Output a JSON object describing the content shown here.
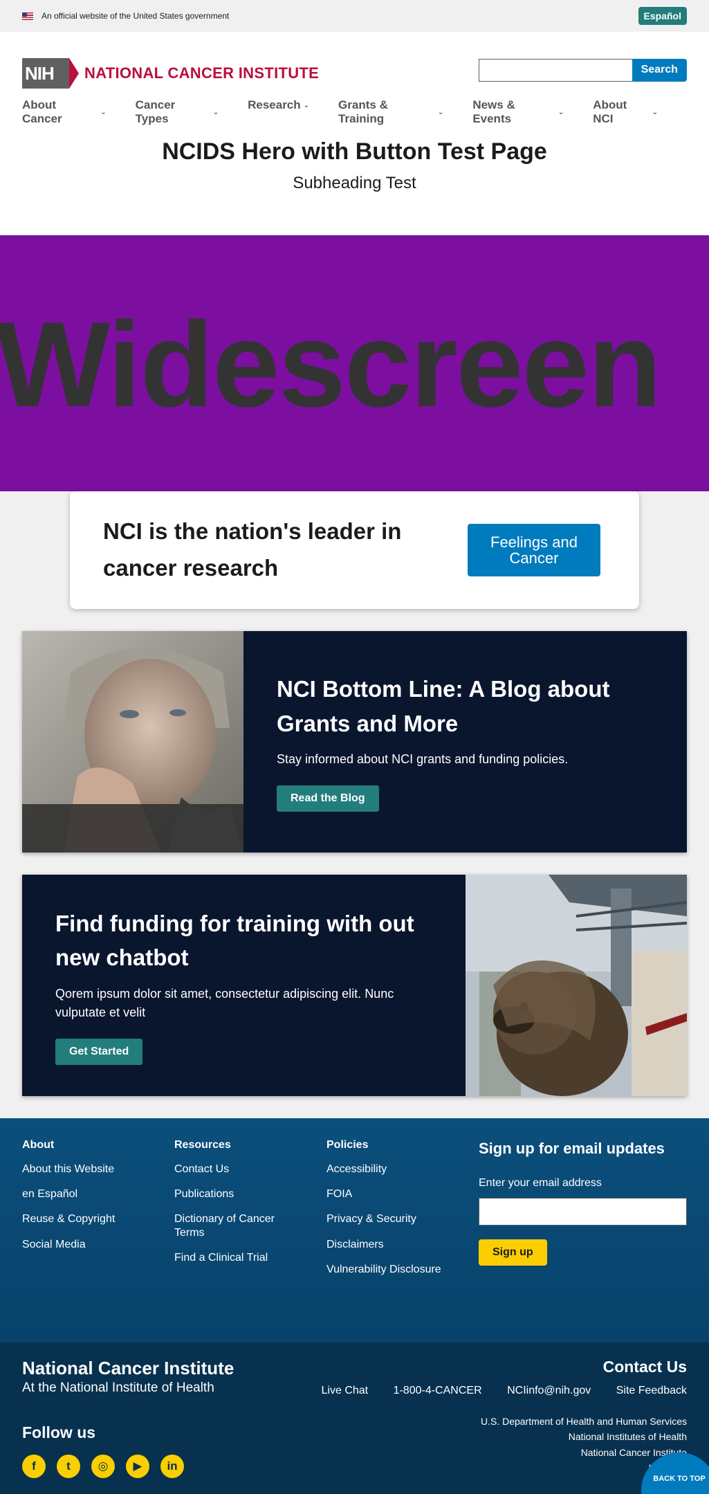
{
  "banner": {
    "text": "An official website of the United States government",
    "lang_button": "Español"
  },
  "header": {
    "logo_text": "NIH",
    "org_name": "NATIONAL CANCER INSTITUTE",
    "search_button": "Search",
    "search_placeholder": ""
  },
  "nav": {
    "items": [
      "About Cancer",
      "Cancer Types",
      "Research",
      "Grants & Training",
      "News & Events",
      "About NCI"
    ]
  },
  "page": {
    "title": "NCIDS Hero with Button Test Page",
    "subtitle": "Subheading Test"
  },
  "hero": {
    "image_text": "Widescreen",
    "background": "#7c0fa0",
    "callout_text": "NCI is the nation's leader in cancer research",
    "callout_button": "Feelings and Cancer"
  },
  "promos": [
    {
      "title": "NCI Bottom Line: A Blog about Grants and More",
      "body": "Stay informed about NCI grants and funding policies.",
      "button": "Read the Blog",
      "image": "elderly-woman-photo"
    },
    {
      "title": "Find funding for training with out new chatbot",
      "body": "Qorem ipsum dolor sit amet, consectetur adipiscing elit. Nunc vulputate et velit",
      "button": "Get Started",
      "image": "dog-bridge-photo"
    }
  ],
  "footer": {
    "columns": [
      {
        "heading": "About",
        "links": [
          "About this Website",
          "en Español",
          "Reuse & Copyright",
          "Social Media"
        ]
      },
      {
        "heading": "Resources",
        "links": [
          "Contact Us",
          "Publications",
          "Dictionary of Cancer Terms",
          "Find a Clinical Trial"
        ]
      },
      {
        "heading": "Policies",
        "links": [
          "Accessibility",
          "FOIA",
          "Privacy & Security",
          "Disclaimers",
          "Vulnerability Disclosure"
        ]
      }
    ],
    "signup": {
      "heading": "Sign up for email updates",
      "label": "Enter your email address",
      "button": "Sign up"
    },
    "org": "National Cancer Institute",
    "suborg": "At the National Institute of Health",
    "follow": "Follow us",
    "contact_heading": "Contact Us",
    "contact_links": [
      "Live Chat",
      "1-800-4-CANCER",
      "NCIinfo@nih.gov",
      "Site Feedback"
    ],
    "agencies": [
      "U.S. Department of Health and Human Services",
      "National Institutes of Health",
      "National Cancer Institute",
      "USA.gov"
    ],
    "back_to_top": "BACK TO TOP",
    "social_icons": [
      "facebook-icon",
      "twitter-icon",
      "instagram-icon",
      "youtube-icon",
      "linkedin-icon"
    ]
  }
}
